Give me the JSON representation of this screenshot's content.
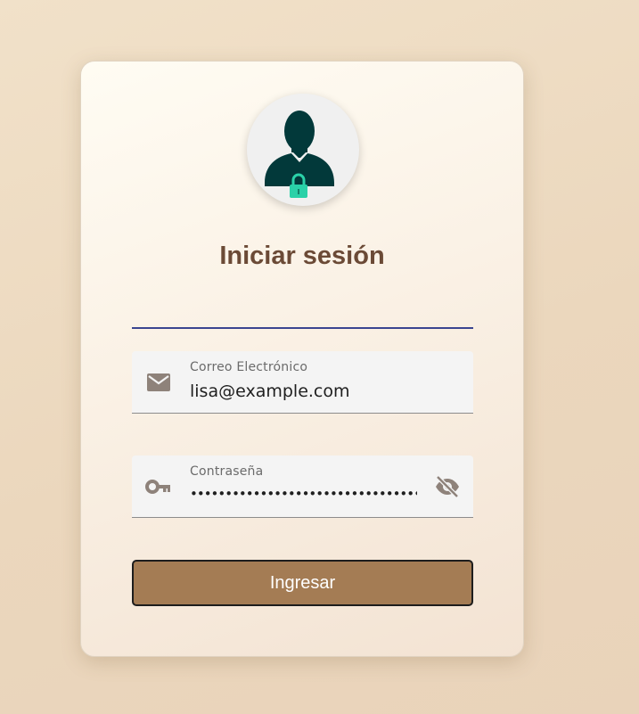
{
  "login": {
    "title": "Iniciar sesión",
    "email": {
      "label": "Correo Electrónico",
      "value": "lisa@example.com",
      "icon": "mail-icon"
    },
    "password": {
      "label": "Contraseña",
      "masked_value": "•••••••••••••••••••••••••••••••••••",
      "icon": "key-icon",
      "toggle_icon": "eye-off-icon"
    },
    "submit_label": "Ingresar",
    "avatar_icon": "user-lock-icon"
  },
  "colors": {
    "accent": "#3a4590",
    "button": "#a47c54",
    "title": "#6b4a36",
    "avatar_figure": "#02393a",
    "lock": "#2ad1a8"
  }
}
